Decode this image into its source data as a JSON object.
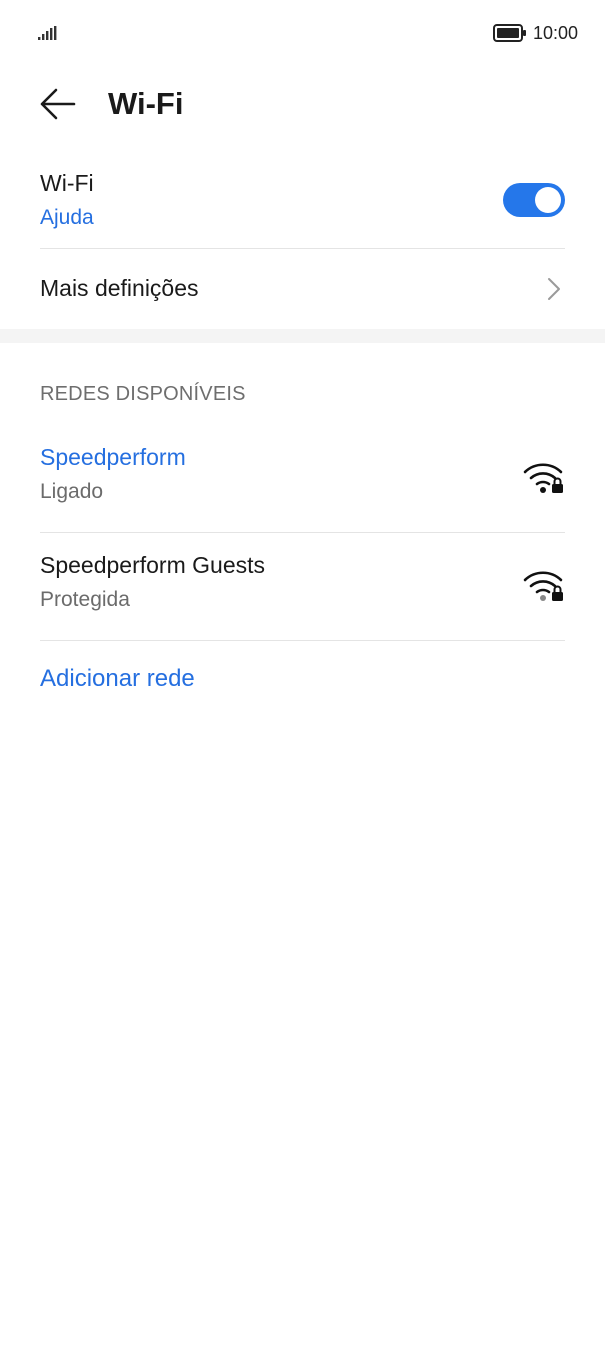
{
  "status_bar": {
    "time": "10:00",
    "signal_icon": "signal-bars-icon",
    "battery_icon": "battery-full-icon"
  },
  "header": {
    "back_icon": "arrow-left-icon",
    "title": "Wi-Fi"
  },
  "wifi_toggle": {
    "label": "Wi-Fi",
    "help_link": "Ajuda",
    "enabled": true,
    "accent": "#2577ea"
  },
  "more_settings": {
    "label": "Mais definições",
    "icon": "chevron-right-icon"
  },
  "available_networks": {
    "header": "REDES DISPONÍVEIS",
    "networks": [
      {
        "name": "Speedperform",
        "status": "Ligado",
        "connected": true,
        "icon": "wifi-locked-icon"
      },
      {
        "name": "Speedperform Guests",
        "status": "Protegida",
        "connected": false,
        "icon": "wifi-locked-icon"
      }
    ],
    "add_network": "Adicionar rede"
  },
  "colors": {
    "link_blue": "#256fe0",
    "text_primary": "#1a1a1a",
    "text_secondary": "#6b6b6b",
    "divider": "#e4e4e4"
  }
}
